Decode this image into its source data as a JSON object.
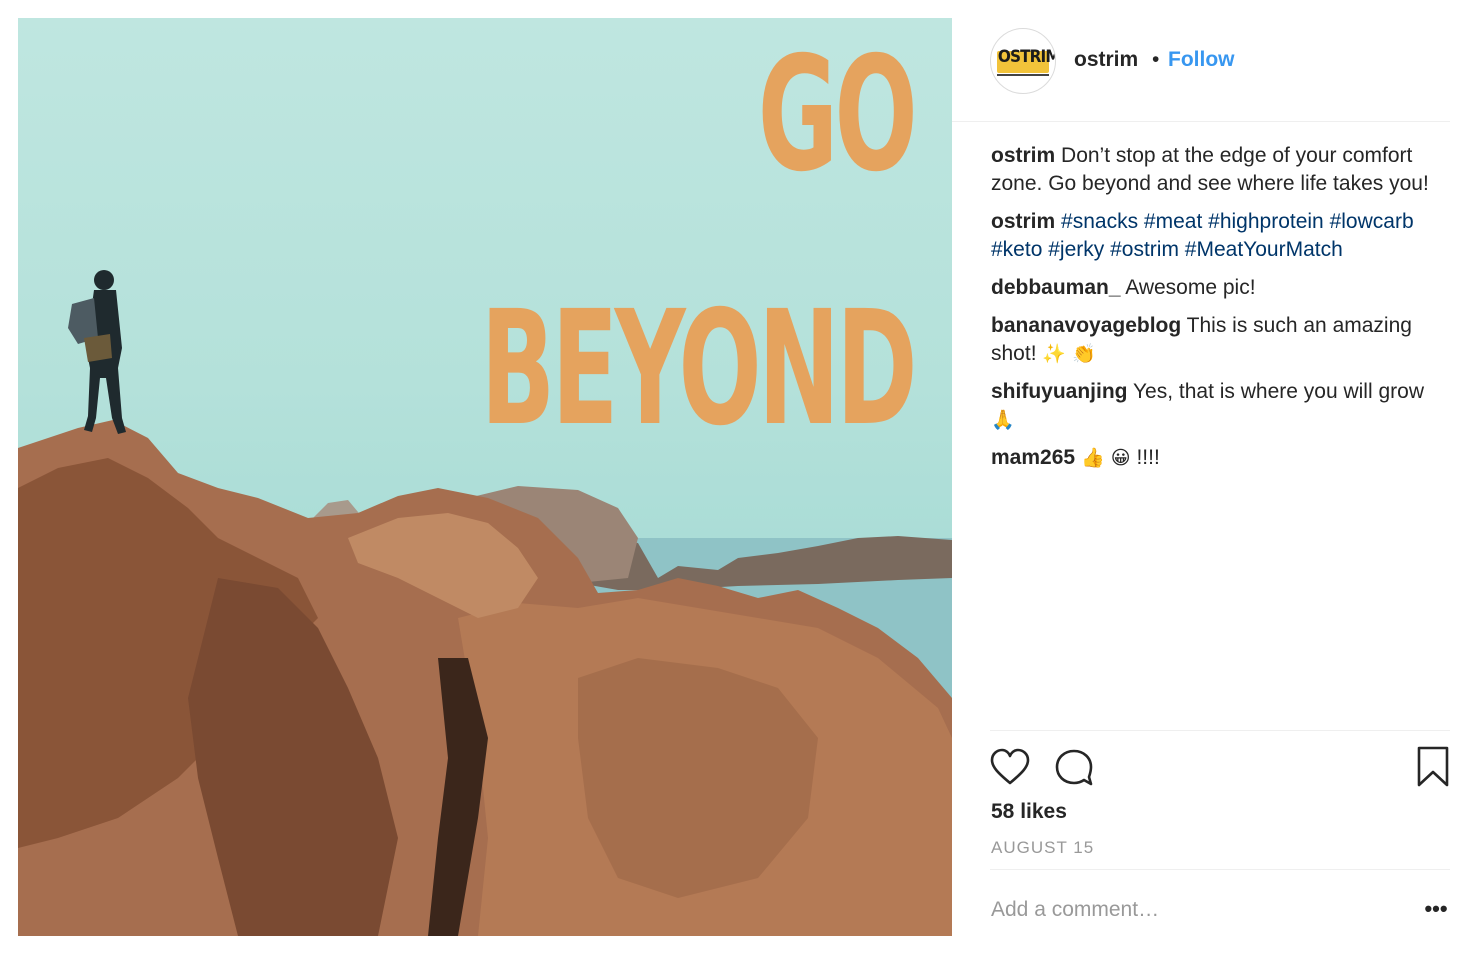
{
  "post": {
    "image": {
      "overlay_line1": "GO",
      "overlay_line2": "BEYOND",
      "overlay_color": "#e5a35e"
    },
    "header": {
      "avatar_text": "OSTRIM",
      "username": "ostrim",
      "separator": "•",
      "follow_label": "Follow",
      "follow_color": "#3897f0"
    },
    "comments": [
      {
        "user": "ostrim",
        "text": " Don’t stop at the edge of your comfort zone. Go beyond and see where life takes you!"
      },
      {
        "user": "ostrim",
        "tags": [
          "#snacks",
          "#meat",
          "#highprotein",
          "#lowcarb",
          "#keto",
          "#jerky",
          "#ostrim",
          "#MeatYourMatch"
        ]
      },
      {
        "user": "debbauman_",
        "text": " Awesome pic!"
      },
      {
        "user": "bananavoyageblog",
        "text": " This is such an amazing shot! ",
        "emoji": "✨ 👏"
      },
      {
        "user": "shifuyuanjing",
        "text": " Yes, that is where you will grow",
        "emoji": "🙏"
      },
      {
        "user": "mam265",
        "emoji": " 👍 😀",
        "text": " !!!!"
      }
    ],
    "actions": {
      "like_icon": "heart-outline-icon",
      "comment_icon": "comment-bubble-icon",
      "save_icon": "bookmark-outline-icon"
    },
    "likes_text": "58 likes",
    "date_text": "AUGUST 15",
    "add_comment_placeholder": "Add a comment…",
    "more_label": "•••",
    "hashtag_color": "#003569"
  }
}
